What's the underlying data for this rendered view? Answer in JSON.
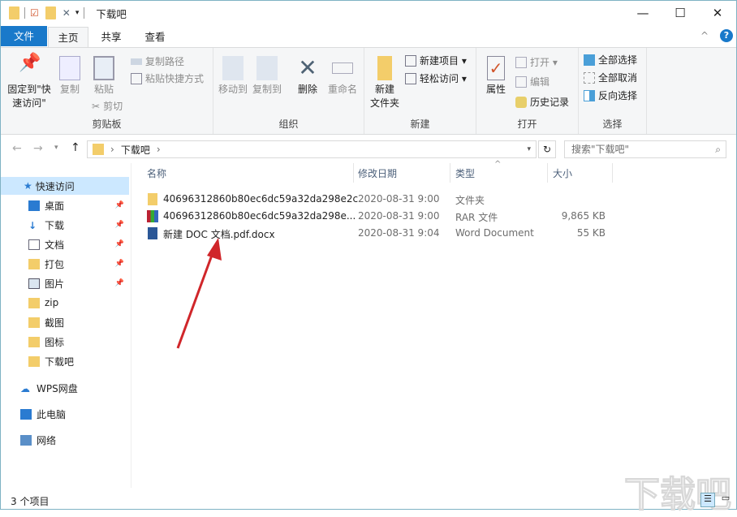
{
  "window": {
    "title": "下载吧",
    "minimize": "—",
    "maximize": "☐",
    "close": "✕"
  },
  "tabs": [
    {
      "label": "文件"
    },
    {
      "label": "主页"
    },
    {
      "label": "共享"
    },
    {
      "label": "查看"
    }
  ],
  "ribbon": {
    "clipboard": {
      "label": "剪贴板",
      "pin": "固定到\"快速访问\"",
      "copy": "复制",
      "paste": "粘贴",
      "copy_path": "复制路径",
      "paste_shortcut": "粘贴快捷方式",
      "cut": "剪切"
    },
    "organize": {
      "label": "组织",
      "move_to": "移动到",
      "copy_to": "复制到",
      "delete": "删除",
      "rename": "重命名"
    },
    "new": {
      "label": "新建",
      "new_folder": "新建\n文件夹",
      "new_item": "新建项目 ▾",
      "easy_access": "轻松访问 ▾"
    },
    "open": {
      "label": "打开",
      "properties": "属性",
      "open": "打开 ▾",
      "edit": "编辑",
      "history": "历史记录"
    },
    "select": {
      "label": "选择",
      "select_all": "全部选择",
      "select_none": "全部取消",
      "invert": "反向选择"
    }
  },
  "address": {
    "path": "下载吧",
    "search_placeholder": "搜索\"下载吧\""
  },
  "nav": {
    "quick_access": "快速访问",
    "items": [
      {
        "label": "桌面",
        "pinned": true
      },
      {
        "label": "下载",
        "pinned": true
      },
      {
        "label": "文档",
        "pinned": true
      },
      {
        "label": "打包",
        "pinned": true
      },
      {
        "label": "图片",
        "pinned": true
      },
      {
        "label": "zip"
      },
      {
        "label": "截图"
      },
      {
        "label": "图标"
      },
      {
        "label": "下载吧"
      }
    ],
    "wps": "WPS网盘",
    "pc": "此电脑",
    "network": "网络"
  },
  "columns": {
    "name": "名称",
    "date": "修改日期",
    "type": "类型",
    "size": "大小"
  },
  "files": [
    {
      "name": "40696312860b80ec6dc59a32da298e2c",
      "date": "2020-08-31 9:00",
      "type": "文件夹",
      "size": "",
      "icon": "folder"
    },
    {
      "name": "40696312860b80ec6dc59a32da298e...",
      "date": "2020-08-31 9:00",
      "type": "RAR 文件",
      "size": "9,865 KB",
      "icon": "rar"
    },
    {
      "name": "新建 DOC 文档.pdf.docx",
      "date": "2020-08-31 9:04",
      "type": "Word Document",
      "size": "55 KB",
      "icon": "word"
    }
  ],
  "status": "3 个项目",
  "colors": {
    "accent": "#1979ca",
    "arrow": "#d0262a",
    "selected": "#cce8ff"
  }
}
